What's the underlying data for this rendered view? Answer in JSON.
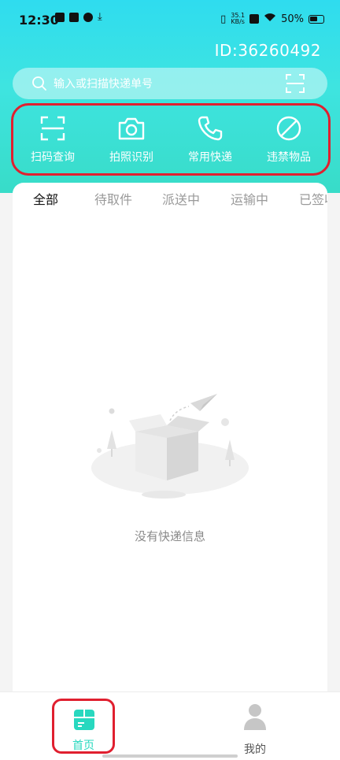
{
  "status_bar": {
    "time": "12:30",
    "net_speed_value": "35.1",
    "net_speed_unit": "KB/s",
    "battery": "50%"
  },
  "header": {
    "user_id": "ID:36260492"
  },
  "search": {
    "placeholder": "输入或扫描快递单号"
  },
  "quick_actions": [
    {
      "label": "扫码查询",
      "icon": "scan-frame-icon"
    },
    {
      "label": "拍照识别",
      "icon": "camera-icon"
    },
    {
      "label": "常用快递",
      "icon": "phone-icon"
    },
    {
      "label": "违禁物品",
      "icon": "prohibited-icon"
    }
  ],
  "tabs": [
    "全部",
    "待取件",
    "派送中",
    "运输中",
    "已签收"
  ],
  "active_tab": "全部",
  "empty_state": {
    "message": "没有快递信息"
  },
  "bottom_nav": {
    "home_label": "首页",
    "mine_label": "我的"
  },
  "colors": {
    "accent": "#28d8bf",
    "highlight_border": "#e01f2f"
  }
}
